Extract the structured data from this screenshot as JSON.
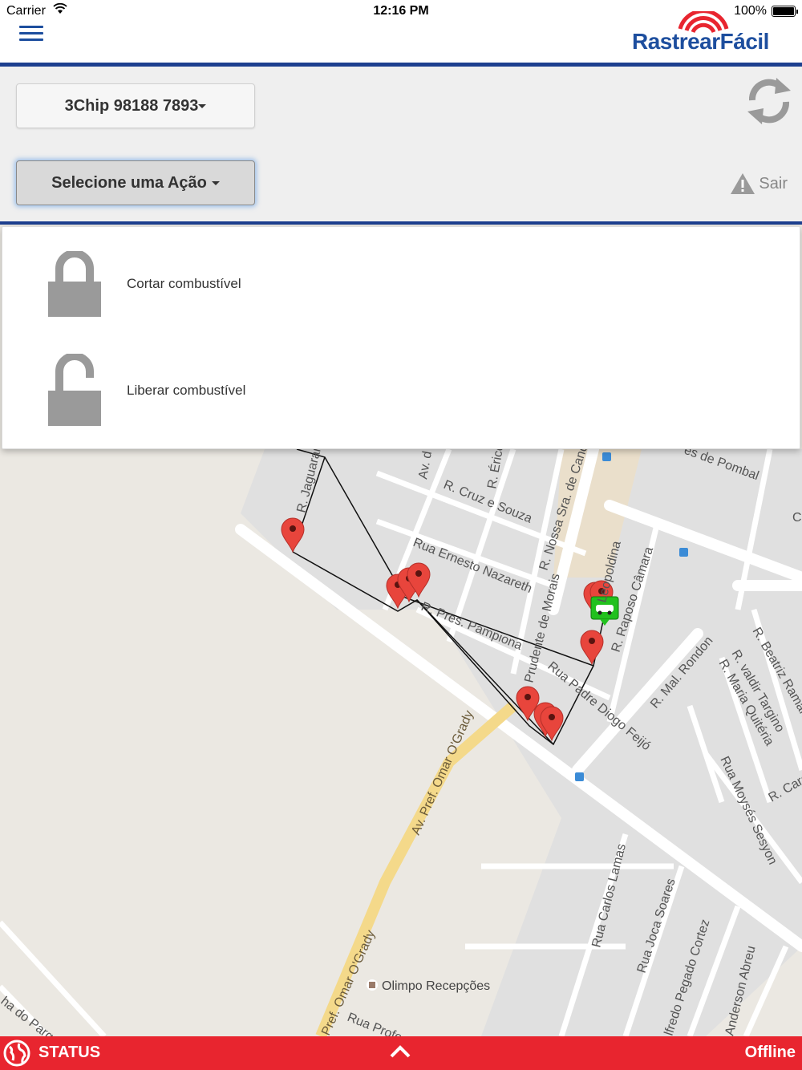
{
  "status_bar": {
    "carrier": "Carrier",
    "time": "12:16 PM",
    "battery": "100%"
  },
  "header": {
    "brand_part1": "Rastrear",
    "brand_part2": "Fácil",
    "menu_icon": "hamburger-menu-icon",
    "logo_icon": "signal-waves-icon"
  },
  "controls": {
    "device_label": "3Chip 98188 7893",
    "action_label": "Selecione uma Ação",
    "refresh_icon": "refresh-icon",
    "logout_label": "Sair",
    "logout_icon": "warning-icon"
  },
  "dropdown": {
    "items": [
      {
        "label": "Cortar combustível",
        "icon": "lock-closed-icon"
      },
      {
        "label": "Liberar combustível",
        "icon": "lock-open-icon"
      }
    ]
  },
  "map": {
    "streets": [
      "R. Jaguarari",
      "Av. d",
      "R. Érico",
      "R. Cruz e Souza",
      "R. Nossa Sra. de Cand",
      "es de Pombal",
      "Rua Ernesto Nazareth",
      "Prudente de Morais",
      "Leopoldina",
      "R. Raposo Câmara",
      "R. Pres. Pampiona",
      "Rua Padre Diogo Feijó",
      "R. Mal. Rondon",
      "R. Beatriz Raman",
      "R. valdir Targino",
      "R. Maria Quitéria",
      "Rua Moysés Sesyon",
      "R. Caran",
      "Av. Pref. Omar O'Grady",
      "Pref. Omar O'Grady",
      "Rua Carlos Lamas",
      "Rua Joca Soares",
      "lfredo Pegado Cortez",
      "Anderson Abreu",
      "Rua Profe",
      "ha do Parque",
      "C"
    ],
    "poi": "Olimpo Recepções",
    "marker_color": "#e8453c",
    "vehicle_color": "#2ecc40"
  },
  "bottom_bar": {
    "status_label": "STATUS",
    "connection": "Offline",
    "globe_icon": "globe-icon",
    "expand_icon": "chevron-up-icon",
    "color": "#e8252f"
  }
}
